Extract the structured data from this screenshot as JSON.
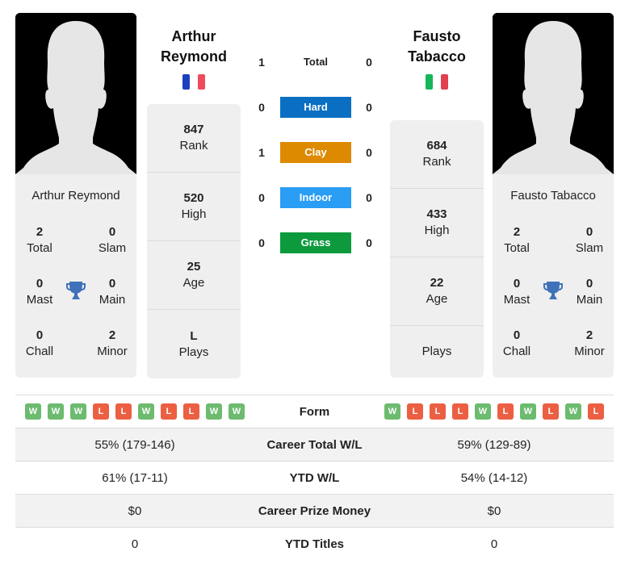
{
  "colors": {
    "hard": "#0a6fc2",
    "clay": "#dd8a00",
    "indoor": "#2a9df4",
    "grass": "#0c9a3d",
    "win": "#6cbb6f",
    "loss": "#ec5f43",
    "trophy": "#3f72b8"
  },
  "player1": {
    "name_line1": "Arthur",
    "name_line2": "Reymond",
    "full_name": "Arthur Reymond",
    "flag": [
      "#1b3fbf",
      "#ffffff",
      "#ef4b5c"
    ],
    "titles": {
      "total": "2",
      "total_label": "Total",
      "slam": "0",
      "slam_label": "Slam",
      "mast": "0",
      "mast_label": "Mast",
      "main": "0",
      "main_label": "Main",
      "chall": "0",
      "chall_label": "Chall",
      "minor": "2",
      "minor_label": "Minor"
    },
    "stats": {
      "rank": "847",
      "rank_label": "Rank",
      "high": "520",
      "high_label": "High",
      "age": "25",
      "age_label": "Age",
      "plays": "L",
      "plays_label": "Plays"
    },
    "form": [
      "W",
      "W",
      "W",
      "L",
      "L",
      "W",
      "L",
      "L",
      "W",
      "W"
    ],
    "career_wl": "55% (179-146)",
    "ytd_wl": "61% (17-11)",
    "prize": "$0",
    "ytd_titles": "0"
  },
  "player2": {
    "name_line1": "Fausto",
    "name_line2": "Tabacco",
    "full_name": "Fausto Tabacco",
    "flag": [
      "#15b55a",
      "#ffffff",
      "#e2404f"
    ],
    "titles": {
      "total": "2",
      "total_label": "Total",
      "slam": "0",
      "slam_label": "Slam",
      "mast": "0",
      "mast_label": "Mast",
      "main": "0",
      "main_label": "Main",
      "chall": "0",
      "chall_label": "Chall",
      "minor": "2",
      "minor_label": "Minor"
    },
    "stats": {
      "rank": "684",
      "rank_label": "Rank",
      "high": "433",
      "high_label": "High",
      "age": "22",
      "age_label": "Age",
      "plays": "",
      "plays_label": "Plays"
    },
    "form": [
      "W",
      "L",
      "L",
      "L",
      "W",
      "L",
      "W",
      "L",
      "W",
      "L"
    ],
    "career_wl": "59% (129-89)",
    "ytd_wl": "54% (14-12)",
    "prize": "$0",
    "ytd_titles": "0"
  },
  "h2h": [
    {
      "label": "Total",
      "p1": "1",
      "p2": "0",
      "type": "total"
    },
    {
      "label": "Hard",
      "p1": "0",
      "p2": "0",
      "type": "hard"
    },
    {
      "label": "Clay",
      "p1": "1",
      "p2": "0",
      "type": "clay"
    },
    {
      "label": "Indoor",
      "p1": "0",
      "p2": "0",
      "type": "indoor"
    },
    {
      "label": "Grass",
      "p1": "0",
      "p2": "0",
      "type": "grass"
    }
  ],
  "table": {
    "form_label": "Form",
    "career_wl_label": "Career Total W/L",
    "ytd_wl_label": "YTD W/L",
    "prize_label": "Career Prize Money",
    "ytd_titles_label": "YTD Titles"
  }
}
